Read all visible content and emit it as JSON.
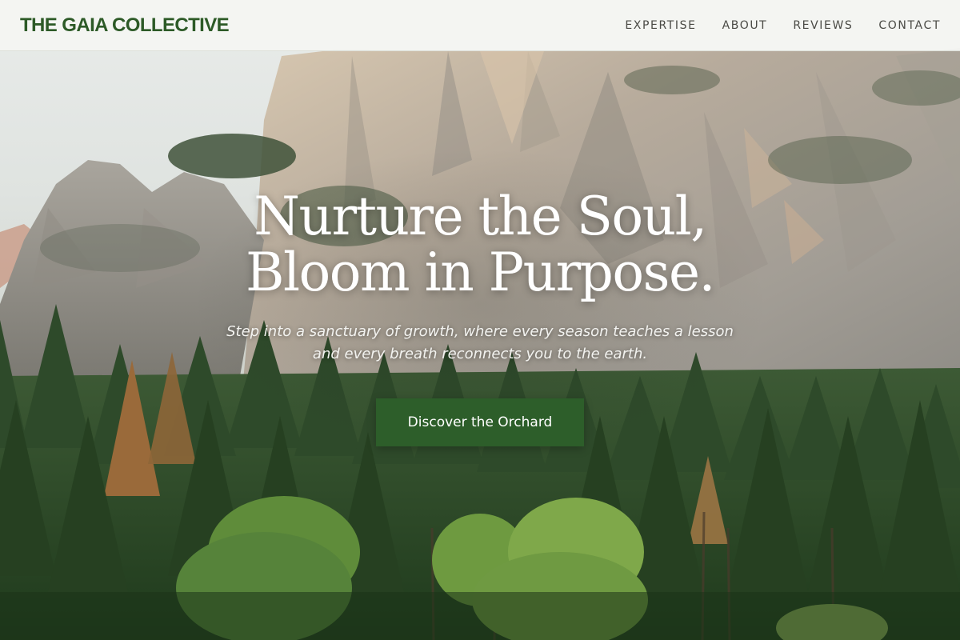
{
  "brand": {
    "name": "THE GAIA COLLECTIVE",
    "color": "#2d5a27"
  },
  "nav": {
    "items": [
      {
        "label": "EXPERTISE"
      },
      {
        "label": "ABOUT"
      },
      {
        "label": "REVIEWS"
      },
      {
        "label": "CONTACT"
      }
    ]
  },
  "hero": {
    "headline_line1": "Nurture the Soul,",
    "headline_line2": "Bloom in Purpose.",
    "subhead_line1": "Step into a sanctuary of growth, where every season teaches a lesson",
    "subhead_line2": "and every breath reconnects you to the earth.",
    "cta_label": "Discover the Orchard",
    "cta_color": "#2d5e2a"
  }
}
